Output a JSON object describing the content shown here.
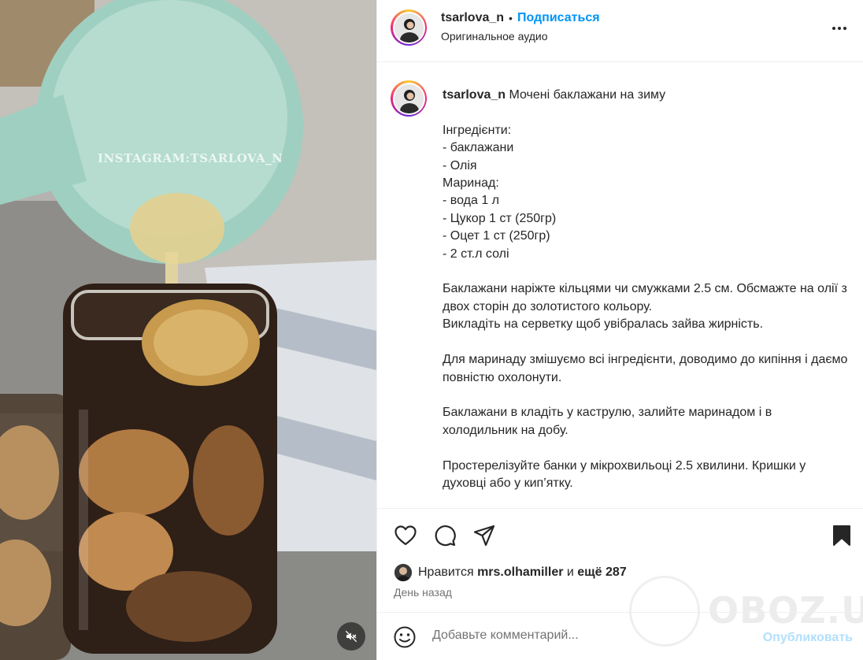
{
  "media": {
    "watermark": "INSTAGRAM:TSARLOVA_N",
    "mute_icon": "speaker-muted-icon"
  },
  "header": {
    "username": "tsarlova_n",
    "separator": "•",
    "follow_label": "Подписаться",
    "audio_label": "Оригинальное аудио",
    "more_icon": "more-horizontal-icon"
  },
  "caption": {
    "username": "tsarlova_n",
    "text": " Мочені баклажани на зиму\n\nІнгредієнти:\n- баклажани\n- Олія\nМаринад:\n- вода 1 л\n- Цукор 1 ст (250гр)\n- Оцет 1 ст (250гр)\n- 2 ст.л солі\n\nБаклажани наріжте кільцями чи смужками 2.5 см. Обсмажте на олії з двох сторін до золотистого кольору.\nВикладіть на серветку щоб увібралась зайва жирність.\n\nДля маринаду змішуємо всі інгредієнти, доводимо до кипіння і даємо повністю охолонути.\n\nБаклажани в кладіть у каструлю, залийте маринадом і в холодильник на добу.\n\nПростерелізуйте банки у мікрохвильоці 2.5 хвилини. Кришки у духовці або у кип’ятку."
  },
  "actions": {
    "like_icon": "heart-icon",
    "comment_icon": "comment-icon",
    "share_icon": "share-icon",
    "save_icon": "bookmark-icon"
  },
  "likes": {
    "prefix": "Нравится",
    "user": "mrs.olhamiller",
    "conj": "и",
    "others": "ещё 287"
  },
  "time": "День назад",
  "comment": {
    "placeholder": "Добавьте комментарий...",
    "post_label": "Опубликовать",
    "emoji_icon": "smiley-icon"
  },
  "site_watermark": "OBOZ.UA",
  "colors": {
    "accent": "#0095f6",
    "post_disabled": "#b2dffc",
    "secondary_text": "#737373",
    "border": "#efefef"
  }
}
